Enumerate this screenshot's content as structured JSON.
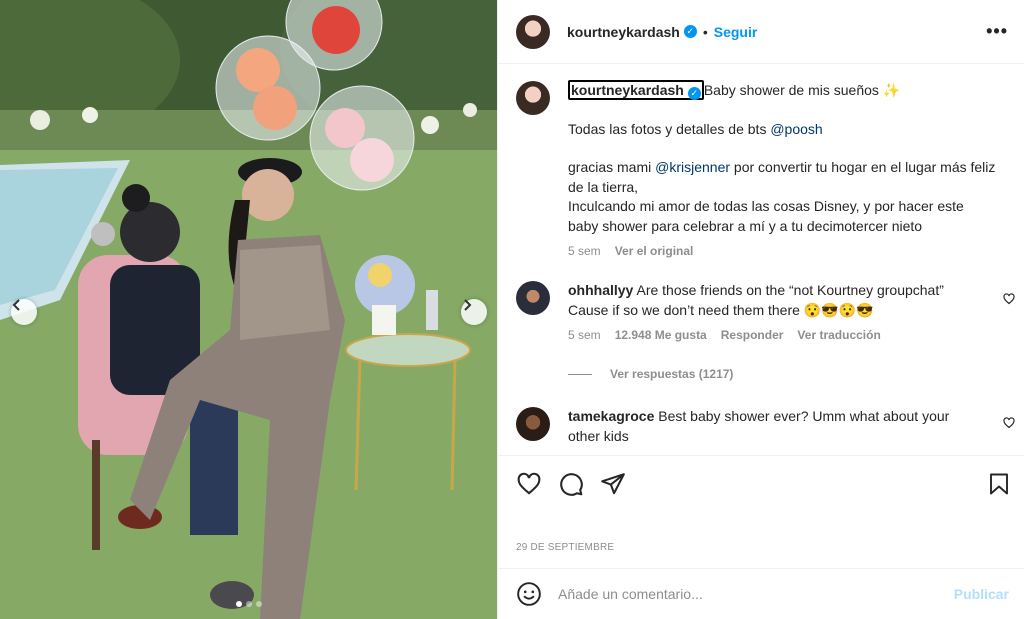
{
  "post": {
    "username": "kourtneykardash",
    "follow_label": "Seguir",
    "separator": "•",
    "more_label": "•••",
    "caption": {
      "username": "kourtneykardash",
      "line1": "Baby shower de mis sueños ✨",
      "line2_prefix": "Todas las fotos y detalles de bts ",
      "line2_mention": "@poosh",
      "line3_prefix": "gracias mami ",
      "line3_mention": "@krisjenner",
      "line3_suffix": " por convertir tu hogar en el lugar más feliz de la tierra,",
      "line4": "Inculcando mi amor de todas las cosas Disney, y por hacer este baby shower para celebrar a mí y a tu decimotercer nieto",
      "time": "5 sem",
      "see_original": "Ver el original"
    },
    "comments": [
      {
        "username": "ohhhallyy",
        "text": "Are those friends on the “not Kourtney groupchat” Cause if so we don’t need them there 😯😎😯😎",
        "time": "5 sem",
        "likes": "12.948 Me gusta",
        "reply": "Responder",
        "translate": "Ver traducción",
        "view_replies": "Ver respuestas (1217)"
      },
      {
        "username": "tamekagroce",
        "text": "Best baby shower ever? Umm what about your other kids"
      }
    ],
    "date": "29 DE SEPTIEMBRE",
    "comment_placeholder": "Añade un comentario...",
    "publish_label": "Publicar"
  },
  "colors": {
    "accent": "#0095f6",
    "publish_disabled": "#b2dffc",
    "mention": "#00376b",
    "secondary_text": "#8e8e8e"
  },
  "icons": [
    "heart-icon",
    "comment-icon",
    "share-icon",
    "bookmark-icon",
    "emoji-icon",
    "verified-icon",
    "chevron-left-icon",
    "chevron-right-icon",
    "more-icon"
  ]
}
